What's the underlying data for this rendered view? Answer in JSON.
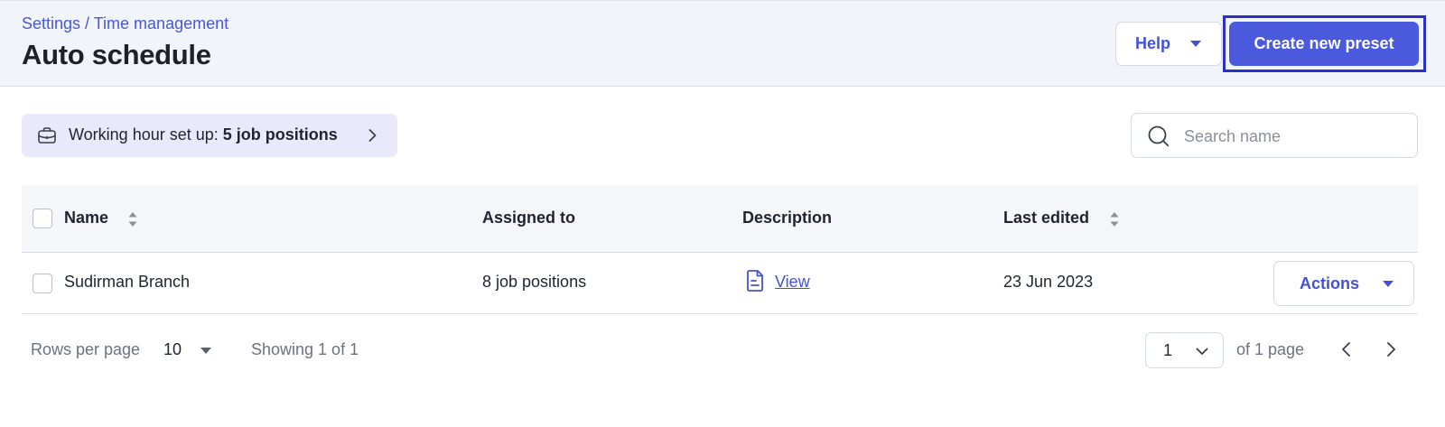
{
  "header": {
    "breadcrumb": "Settings / Time management",
    "title": "Auto schedule",
    "help_label": "Help",
    "create_label": "Create new preset"
  },
  "working_hours": {
    "prefix": "Working hour set up: ",
    "value": "5 job positions"
  },
  "search": {
    "placeholder": "Search name",
    "value": ""
  },
  "table": {
    "columns": [
      "Name",
      "Assigned to",
      "Description",
      "Last edited"
    ],
    "rows": [
      {
        "name": "Sudirman Branch",
        "assigned_to": "8 job positions",
        "description_link": "View",
        "last_edited": "23 Jun 2023",
        "actions_label": "Actions"
      }
    ]
  },
  "pagination": {
    "rows_per_page_label": "Rows per page",
    "rows_per_page_value": "10",
    "showing": "Showing 1 of 1",
    "current_page": "1",
    "page_total": "of 1 page"
  },
  "colors": {
    "accent": "#4b59dd",
    "link": "#4451d6",
    "header_bg": "#f1f4f9",
    "chip_bg": "#e8eafb",
    "focus_outline": "#2b30c9"
  },
  "icons": {
    "working_hours": "briefcase-icon",
    "search": "search-icon",
    "description": "document-icon",
    "sort": "sort-icon"
  }
}
